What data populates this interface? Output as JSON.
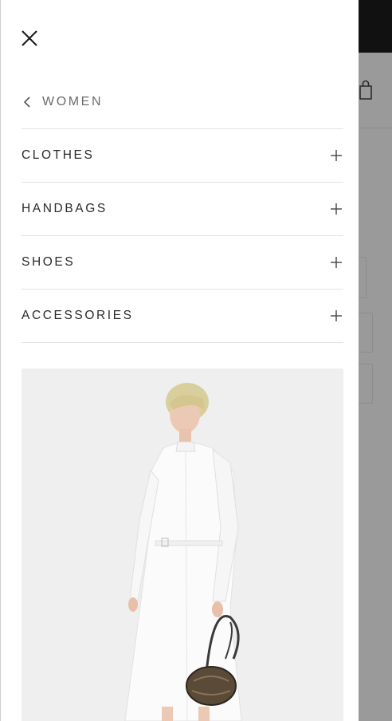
{
  "drawer": {
    "close_icon": "close-icon",
    "back": {
      "icon": "chevron-left-icon",
      "label": "WOMEN"
    },
    "menu_items": [
      {
        "label": "CLOTHES",
        "icon": "plus-icon"
      },
      {
        "label": "HANDBAGS",
        "icon": "plus-icon"
      },
      {
        "label": "SHOES",
        "icon": "plus-icon"
      },
      {
        "label": "ACCESSORIES",
        "icon": "plus-icon"
      }
    ],
    "promo_image": "model-in-white-shirt-dress-with-handbag"
  },
  "background_page": {
    "icons": [
      "chevron-right-icon",
      "shopping-bag-icon"
    ]
  },
  "colors": {
    "drawer_bg": "#ffffff",
    "overlay": "#9a9a9a",
    "text": "#2a2a2a",
    "muted_text": "#6b6b6b",
    "divider": "#e3e3e3",
    "promo_bg": "#efefef",
    "topbar": "#111111"
  }
}
